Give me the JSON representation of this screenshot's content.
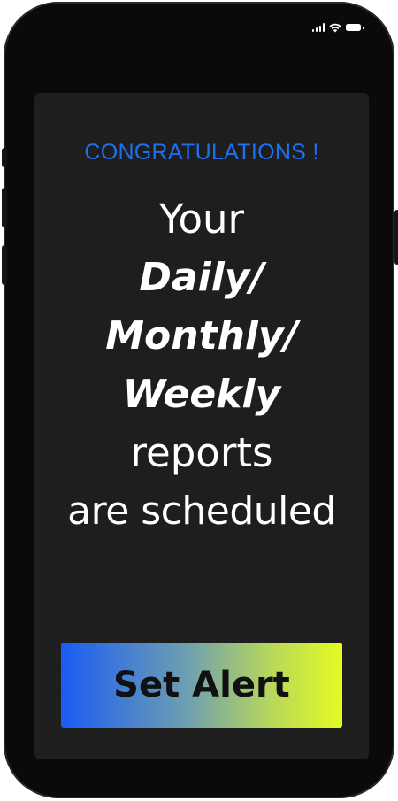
{
  "status_bar": {
    "icons": [
      "signal-icon",
      "wifi-icon",
      "battery-icon"
    ]
  },
  "card": {
    "headline": "CONGRATULATIONS !",
    "line1": "Your",
    "line2": "Daily/",
    "line3": "Monthly/",
    "line4": "Weekly",
    "line5": "reports",
    "line6": "are scheduled"
  },
  "action": {
    "button_label": "Set Alert"
  },
  "colors": {
    "headline": "#1f6ff2",
    "card_bg": "#1e1e1e",
    "gradient_start": "#1a5cf5",
    "gradient_end": "#e4fb22"
  }
}
